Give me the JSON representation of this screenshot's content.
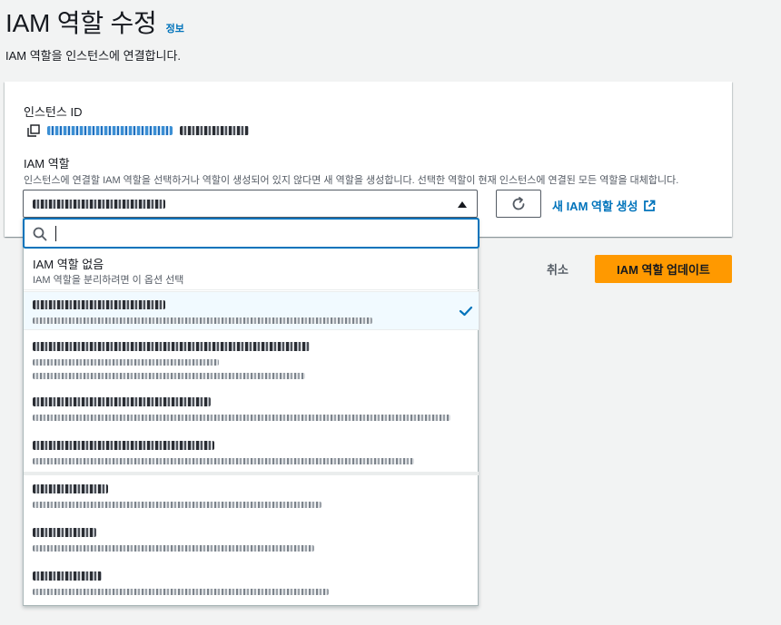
{
  "page": {
    "title": "IAM 역할 수정",
    "info_link": "정보",
    "description": "IAM 역할을 인스턴스에 연결합니다."
  },
  "form": {
    "instance_id_label": "인스턴스 ID",
    "iam_role_label": "IAM 역할",
    "iam_role_help": "인스턴스에 연결할 IAM 역할을 선택하거나 역할이 생성되어 있지 않다면 새 역할을 생성합니다. 선택한 역할이 현재 인스턴스에 연결된 모든 역할을 대체합니다.",
    "new_role_link": "새 IAM 역할 생성",
    "search_value": ""
  },
  "dropdown": {
    "none_option": {
      "title": "IAM 역할 없음",
      "subtitle": "IAM 역할을 분리하려면 이 옵션 선택"
    }
  },
  "actions": {
    "cancel_label": "취소",
    "update_label": "IAM 역할 업데이트"
  },
  "colors": {
    "link": "#0073bb",
    "primary_button": "#ff9900",
    "selected_option_bg": "#f1faff"
  },
  "icons": [
    "copy-icon",
    "caret-up-icon",
    "refresh-icon",
    "external-link-icon",
    "search-icon",
    "check-icon"
  ]
}
